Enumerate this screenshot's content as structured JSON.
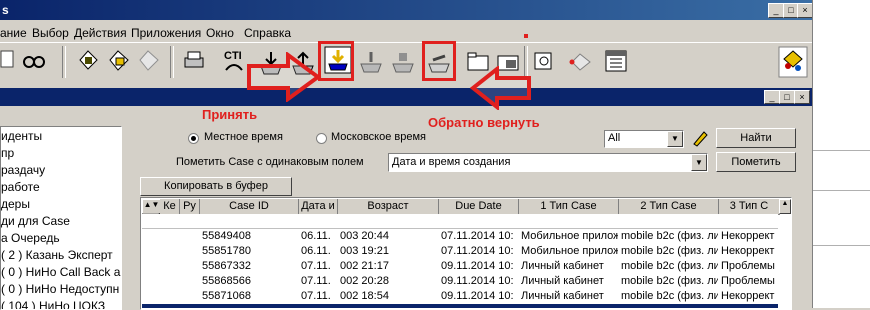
{
  "window": {
    "title_fragment": "s"
  },
  "menu": [
    "ание",
    "Выбор",
    "Действия",
    "Приложения",
    "Окно",
    "Справка"
  ],
  "toolbar": {
    "cti_label": "CTI"
  },
  "annotations": {
    "accept": "Принять",
    "return_back": "Обратно вернуть",
    "accent": "#e0201e"
  },
  "time_options": {
    "local": "Местное время",
    "moscow": "Московское время"
  },
  "filter": {
    "value": "All",
    "find_button": "Найти"
  },
  "mark_case": {
    "label": "Пометить Case с одинаковым полем",
    "value": "Дата и время создания",
    "button": "Пометить"
  },
  "copy_button": "Копировать в буфер",
  "tree": {
    "items": [
      "иденты",
      "пр",
      "раздачу",
      "работе",
      "деры",
      "ди для Case",
      "а Очередь",
      "( 2 ) Казань Эксперт",
      "( 0 ) НиНо Call Back а",
      "( 0 ) НиНо Недоступн",
      "( 104 ) НиНо ЦОКЗ"
    ]
  },
  "table": {
    "headers": [
      "Ке",
      "Ру",
      "Case ID",
      "Дата и",
      "Возраст",
      "Due Date",
      "1 Тип Case",
      "2 Тип Case",
      "3 Тип С"
    ],
    "rows": [
      [
        "",
        "",
        "55849408",
        "06.11.",
        "003 20:44",
        "07.11.2014 10:",
        "Мобильное прилож",
        "mobile b2c (физ. ли",
        "Некоррект"
      ],
      [
        "",
        "",
        "55851780",
        "06.11.",
        "003 19:21",
        "07.11.2014 10:",
        "Мобильное прилож",
        "mobile b2c (физ. ли",
        "Некоррект"
      ],
      [
        "",
        "",
        "55867332",
        "07.11.",
        "002 21:17",
        "09.11.2014 10:",
        "Личный кабинет",
        "mobile b2c (физ. ли",
        "Проблемы"
      ],
      [
        "",
        "",
        "55868566",
        "07.11.",
        "002 20:28",
        "09.11.2014 10:",
        "Личный кабинет",
        "mobile b2c (физ. ли",
        "Проблемы"
      ],
      [
        "",
        "",
        "55871068",
        "07.11.",
        "002 18:54",
        "09.11.2014 10:",
        "Личный кабинет",
        "mobile b2c (физ. ли",
        "Некоррект"
      ]
    ]
  }
}
